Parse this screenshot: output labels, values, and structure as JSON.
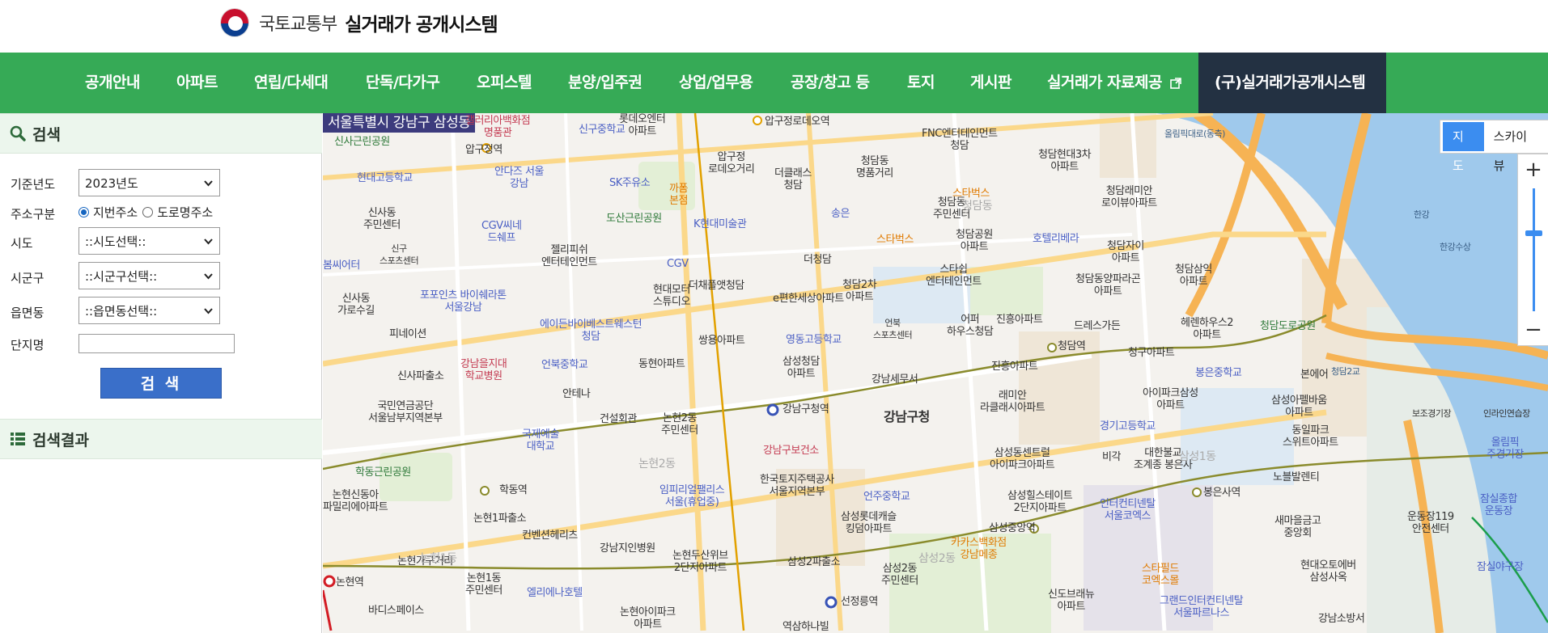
{
  "header": {
    "org_name": "국토교통부",
    "site_title": "실거래가 공개시스템"
  },
  "nav": {
    "items": [
      "공개안내",
      "아파트",
      "연립/다세대",
      "단독/다가구",
      "오피스텔",
      "분양/입주권",
      "상업/업무용",
      "공장/창고 등",
      "토지",
      "게시판",
      "실거래가 자료제공"
    ],
    "old_system": "(구)실거래가공개시스템",
    "colors": {
      "bar": "#36aa56",
      "old_system_bg": "#233142"
    }
  },
  "sidebar": {
    "search_title": "검색",
    "year_label": "기준년도",
    "year_value": "2023년도",
    "addr_type_label": "주소구분",
    "addr_opt_lot": "지번주소",
    "addr_opt_road": "도로명주소",
    "sido_label": "시도",
    "sido_value": "::시도선택::",
    "sigungu_label": "시군구",
    "sigungu_value": "::시군구선택::",
    "emd_label": "읍면동",
    "emd_value": "::읍면동선택::",
    "complex_label": "단지명",
    "complex_value": "",
    "search_button": "검 색",
    "results_title": "검색결과"
  },
  "map": {
    "current_address": "서울특별시 강남구 삼성동",
    "map_type_map": "지도",
    "map_type_sky": "스카이뷰",
    "zoom_in": "+",
    "zoom_out": "−",
    "labels": {
      "l1": "신사근린공원",
      "l2": "압구정역",
      "l3": "신구중학교",
      "l4": "압구정로데오역",
      "l5": "FNC엔터테인먼트\n청담",
      "l6": "청담현대3차\n아파트",
      "l7": "현대고등학교",
      "l8": "안다즈 서울\n강남",
      "l9": "SK주유소",
      "l10": "까폼\n본점",
      "l11": "압구정\n로데오거리",
      "l12": "더클래스\n청담",
      "l13": "청담동\n명품거리",
      "l14": "스타벅스",
      "l15": "청담래미안\n로이뷰아파트",
      "l16": "신사동\n주민센터",
      "l17": "CGV씨네\n드쉐프",
      "l18": "도산근린공원",
      "l19": "K현대미술관",
      "l20": "송은",
      "l21": "청담동\n주민센터",
      "l22": "젤리피쉬\n엔터테인먼트",
      "l23": "CGV",
      "l24": "청담공원\n아파트",
      "l25": "호텔리베라",
      "l26": "청담자이\n아파트",
      "l27": "스타벅스",
      "l28": "더청담",
      "l29": "스타쉽\n엔터테인먼트",
      "l30": "청담2차\n아파트",
      "l31": "청담동양파라곤\n아파트",
      "l32": "청담삼익\n아파트",
      "l33": "현대모터\n스튜디오",
      "l34": "더채플앳청담",
      "l35": "e편한세상아파트",
      "l36": "포포인츠 바이쉐라톤\n서울강남",
      "l37": "어퍼\n하우스청담",
      "l38": "진흥아파트",
      "l39": "드레스가든",
      "l40": "헤렌하우스2\n아파트",
      "l41": "청담도로공원",
      "l42": "에이든바이베스트웨스턴\n청담",
      "l43": "영동고등학교",
      "l44": "언북\n스포츠센터",
      "l45": "청담역",
      "l46": "청구아파트",
      "l47": "피네이션",
      "l48": "쌍용아파트",
      "l49": "신사파출소",
      "l50": "강남을지대\n학교병원",
      "l51": "언북중학교",
      "l52": "동현아파트",
      "l53": "삼성청담\n아파트",
      "l54": "진흥아파트",
      "l55": "봉은중학교",
      "l56": "본에어",
      "l57": "강남세무서",
      "l58": "아이파크삼성\n아파트",
      "l59": "삼성아펠바움\n아파트",
      "l60": "국민연금공단\n서울남부지역본부",
      "l61": "안테나",
      "l62": "건설회관",
      "l63": "논현2동\n주민센터",
      "l64": "강남구청역",
      "l65": "강남구청",
      "l66": "래미안\n라클래시아파트",
      "l67": "경기고등학교",
      "l68": "동일파크\n스위트아파트",
      "l69": "국제예술\n대학교",
      "l70": "강남구보건소",
      "l71": "삼성동센트럴\n아이파크아파트",
      "l72": "비각",
      "l73": "대한불교\n조계종 봉은사",
      "l74": "노블발렌티",
      "l75": "올림픽\n주경기장",
      "l76": "학동근린공원",
      "l77": "학동역",
      "l78": "한국토지주택공사\n서울지역본부",
      "l79": "임피리얼팰리스\n서울(휴업중)",
      "l80": "봉은사역",
      "l81": "논현신동아\n파밀리에아파트",
      "l82": "논현1파출소",
      "l83": "언주중학교",
      "l84": "삼성힐스테이트\n2단지아파트",
      "l85": "인터컨티넨탈\n서울코엑스",
      "l86": "새마을금고\n중앙회",
      "l87": "운동장119\n안전센터",
      "l88": "잠실종합\n운동장",
      "l89": "컨벤션헤리츠",
      "l90": "강남지인병원",
      "l91": "삼성롯데캐슬\n킹덤아파트",
      "l92": "삼성중앙역",
      "l93": "논현가구거리",
      "l94": "논현두산위브\n2단지아파트",
      "l95": "삼성2파출소",
      "l96": "카카스백화점\n강남메종",
      "l97": "현대오토에버\n삼성사옥",
      "l98": "잠실야구장",
      "l99": "논현역",
      "l100": "논현1동\n주민센터",
      "l101": "엘리에나호텔",
      "l102": "삼성2동\n주민센터",
      "l103": "스타필드\n코엑스몰",
      "l104": "바디스페이스",
      "l105": "선정릉역",
      "l106": "신도브래뉴\n아파트",
      "l107": "그랜드인터컨티넨탈\n서울파르나스",
      "l108": "강남소방서",
      "l109": "논현아이파크\n아파트",
      "l110": "역삼하나빌",
      "l111": "청담2교",
      "l112": "보조경기장",
      "l113": "인라인연습장",
      "l114": "신사동\n가로수길",
      "l115": "신구\n스포츠센터",
      "l116": "롯데오엔터\n아파트",
      "l117": "갤러리아백화점\n명품관",
      "l118": "봄씨어터",
      "l119": "논현2동",
      "l120": "삼성1동",
      "l121": "논현1동",
      "l122": "삼성2동",
      "l123": "청담동",
      "l124": "한강",
      "l125": "한강수상",
      "l126": "올림픽대로(동측)"
    }
  }
}
